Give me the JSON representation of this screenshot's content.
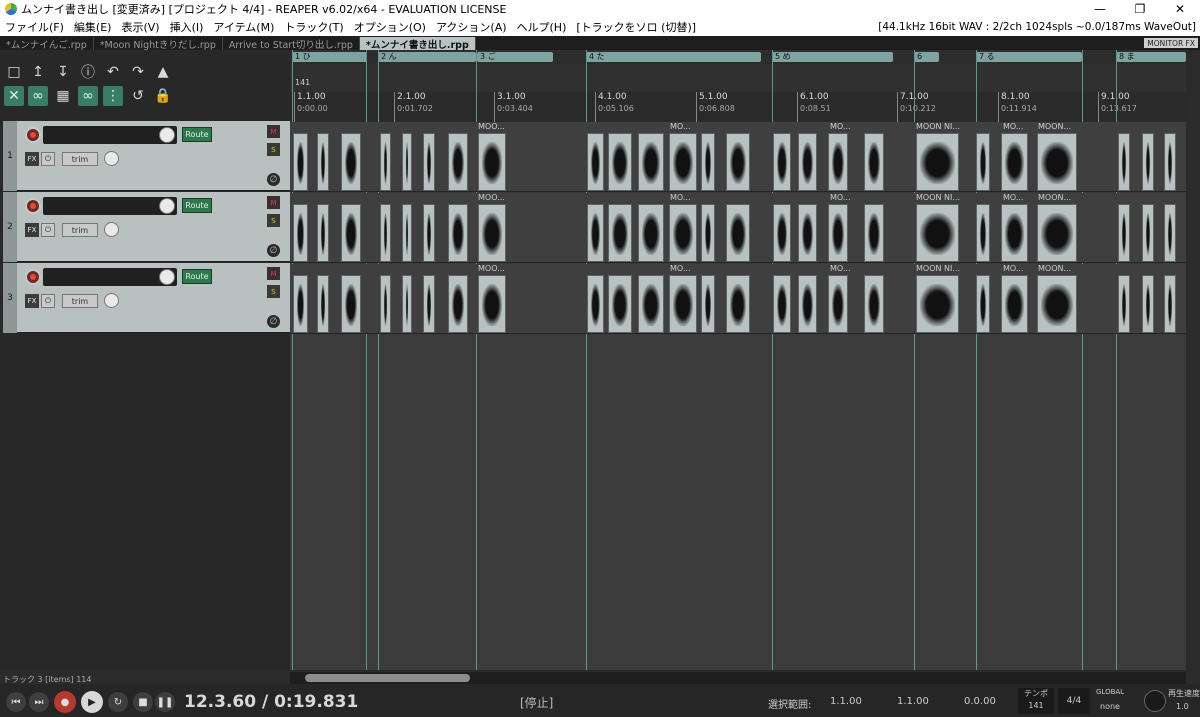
{
  "window": {
    "title": "ムンナイ書き出し [変更済み] [プロジェクト 4/4] - REAPER v6.02/x64 - EVALUATION LICENSE",
    "minimize": "—",
    "restore": "❐",
    "close": "✕"
  },
  "menu": {
    "items": [
      "ファイル(F)",
      "編集(E)",
      "表示(V)",
      "挿入(I)",
      "アイテム(M)",
      "トラック(T)",
      "オプション(O)",
      "アクション(A)",
      "ヘルプ(H)",
      "[トラックをソロ (切替)]"
    ],
    "status": "[44.1kHz 16bit WAV : 2/2ch 1024spls ~0.0/187ms WaveOut]"
  },
  "tabs": [
    {
      "label": "*ムンナイんご.rpp"
    },
    {
      "label": "*Moon Nightきりだし.rpp"
    },
    {
      "label": "Arrive to Start切り出し.rpp"
    },
    {
      "label": "*ムンナイ書き出し.rpp"
    }
  ],
  "monitor_fx": "MONITOR FX",
  "tracks": [
    {
      "number": "1",
      "route": "Route",
      "fx": "FX",
      "trim": "trim",
      "mute": "M",
      "solo": "S"
    },
    {
      "number": "2",
      "route": "Route",
      "fx": "FX",
      "trim": "trim",
      "mute": "M",
      "solo": "S"
    },
    {
      "number": "3",
      "route": "Route",
      "fx": "FX",
      "trim": "trim",
      "mute": "M",
      "solo": "S"
    }
  ],
  "regions": [
    {
      "label": "1 ひ"
    },
    {
      "label": "2 ん"
    },
    {
      "label": "3 ご"
    },
    {
      "label": "4 た"
    },
    {
      "label": "5 め"
    },
    {
      "label": "6"
    },
    {
      "label": "7 る"
    },
    {
      "label": "8 ま"
    }
  ],
  "tempo_marker": "141",
  "ruler": [
    {
      "bar": "1.1.00",
      "time": "0:00.00"
    },
    {
      "bar": "2.1.00",
      "time": "0:01.702"
    },
    {
      "bar": "3.1.00",
      "time": "0:03.404"
    },
    {
      "bar": "4.1.00",
      "time": "0:05.106"
    },
    {
      "bar": "5.1.00",
      "time": "0:06.808"
    },
    {
      "bar": "6.1.00",
      "time": "0:08.51"
    },
    {
      "bar": "7.1.00",
      "time": "0:10.212"
    },
    {
      "bar": "8.1.00",
      "time": "0:11.914"
    },
    {
      "bar": "9.1.00",
      "time": "0:13.617"
    }
  ],
  "item_labels": {
    "moo": "MOO...",
    "mo": "MO...",
    "moon_ni": "MOON NI...",
    "moon": "MOON..."
  },
  "status_left": "トラック 3 [items] 114",
  "transport": {
    "position": "12.3.60 / 0:19.831",
    "state": "[停止]",
    "selection_label": "選択範囲:",
    "sel_start": "1.1.00",
    "sel_end": "1.1.00",
    "sel_len": "0.0.00",
    "tempo_label": "テンポ",
    "tempo": "141",
    "timesig": "4/4",
    "global_label": "GLOBAL",
    "global_value": "none",
    "rate_label": "再生速度",
    "rate": "1.0"
  }
}
